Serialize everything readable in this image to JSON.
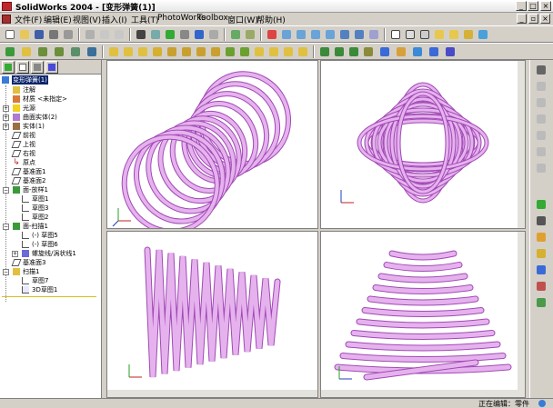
{
  "window": {
    "title": "SolidWorks 2004 - [变形弹簧(1)]",
    "minimize": "_",
    "maximize": "□",
    "close": "×"
  },
  "menubar": {
    "items": [
      "文件(F)",
      "编辑(E)",
      "视图(V)",
      "插入(I)",
      "工具(T)",
      "PhotoWorks",
      "Toolbox",
      "窗口(W)",
      "帮助(H)"
    ]
  },
  "feature_tree": {
    "root": "变形弹簧(1)",
    "items": [
      {
        "label": "注解",
        "icon": "annotations-icon"
      },
      {
        "label": "材质 <未指定>",
        "icon": "material-icon"
      },
      {
        "label": "光源",
        "icon": "lights-icon"
      },
      {
        "label": "曲面实体(2)",
        "icon": "surface-bodies-icon"
      },
      {
        "label": "实体(1)",
        "icon": "solid-bodies-icon"
      },
      {
        "label": "前视",
        "icon": "plane-icon"
      },
      {
        "label": "上视",
        "icon": "plane-icon"
      },
      {
        "label": "右视",
        "icon": "plane-icon"
      },
      {
        "label": "原点",
        "icon": "origin-icon"
      },
      {
        "label": "基准面1",
        "icon": "plane-icon"
      },
      {
        "label": "基准面2",
        "icon": "plane-icon"
      },
      {
        "label": "面-放样1",
        "icon": "loft-icon"
      },
      {
        "label": "草图1",
        "icon": "sketch-icon"
      },
      {
        "label": "草图3",
        "icon": "sketch-icon"
      },
      {
        "label": "草图2",
        "icon": "sketch-icon"
      },
      {
        "label": "面-扫描1",
        "icon": "sweep-icon"
      },
      {
        "label": "(-) 草图5",
        "icon": "sketch-icon"
      },
      {
        "label": "(-) 草图6",
        "icon": "sketch-icon"
      },
      {
        "label": "螺旋线/涡状线1",
        "icon": "helix-icon"
      },
      {
        "label": "基准面3",
        "icon": "plane-icon"
      },
      {
        "label": "扫描1",
        "icon": "sweep-icon"
      },
      {
        "label": "草图7",
        "icon": "sketch-icon"
      },
      {
        "label": "3D草图1",
        "icon": "sketch3d-icon"
      }
    ]
  },
  "statusbar": {
    "text": "正在编辑：零件"
  },
  "colors": {
    "spring": "#e6b2ee",
    "spring_dark": "#a04ab4",
    "selection": "#0a246a"
  }
}
